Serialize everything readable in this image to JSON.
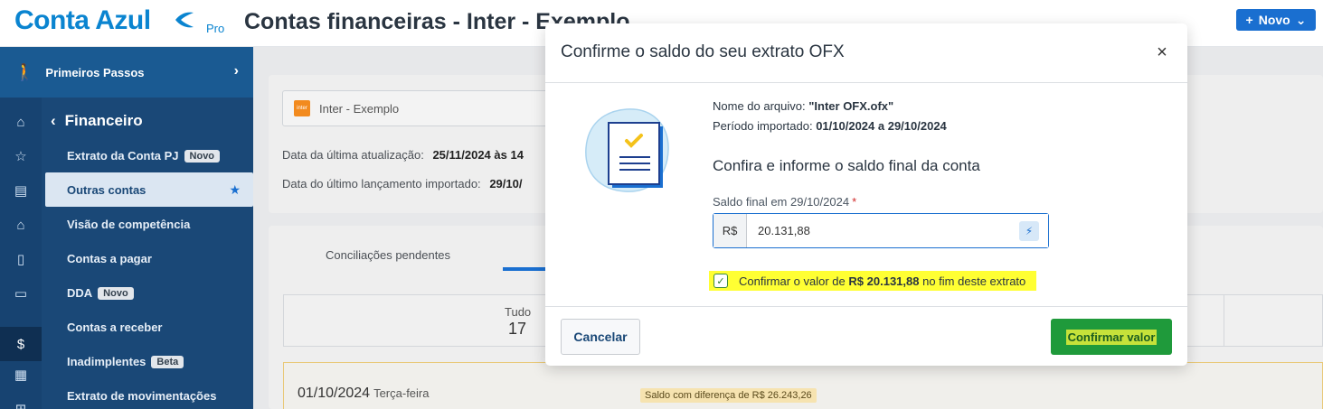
{
  "header": {
    "logo_text": "Conta Azul",
    "logo_badge": "Pro",
    "page_title": "Contas financeiras - Inter - Exemplo",
    "new_button_label": "Novo"
  },
  "sidebar": {
    "first_steps_label": "Primeiros Passos",
    "section_label": "Financeiro",
    "items": [
      {
        "label": "Extrato da Conta PJ",
        "tag": "Novo"
      },
      {
        "label": "Outras contas"
      },
      {
        "label": "Visão de competência"
      },
      {
        "label": "Contas a pagar"
      },
      {
        "label": "DDA",
        "tag": "Novo"
      },
      {
        "label": "Contas a receber"
      },
      {
        "label": "Inadimplentes",
        "tag": "Beta"
      },
      {
        "label": "Extrato de movimentações"
      }
    ]
  },
  "background": {
    "account_name": "Inter - Exemplo",
    "account_logo_text": "inter",
    "last_update_label": "Data da última atualização:",
    "last_update_value": "25/11/2024 às 14",
    "last_import_label": "Data do último lançamento importado:",
    "last_import_value": "29/10/",
    "tab_pending": "Conciliações pendentes",
    "summary_label": "Tudo",
    "summary_value": "17",
    "row_date": "01/10/2024",
    "row_weekday": "Terça-feira",
    "row_badge": "Saldo com diferença de R$ 26.243,26"
  },
  "modal": {
    "title": "Confirme o saldo do seu extrato OFX",
    "file_label": "Nome do arquivo:",
    "file_value": "\"Inter OFX.ofx\"",
    "period_label": "Período importado:",
    "period_value": "01/10/2024 a 29/10/2024",
    "subtitle": "Confira e informe o saldo final da conta",
    "field_label": "Saldo final em 29/10/2024",
    "required_mark": "*",
    "currency_prefix": "R$",
    "field_value": "20.131,88",
    "confirm_text_before": "Confirmar o valor de",
    "confirm_amount": "R$ 20.131,88",
    "confirm_text_after": "no fim deste extrato",
    "confirm_checked": true,
    "cancel_label": "Cancelar",
    "submit_label": "Confirmar valor"
  },
  "colors": {
    "brand": "#0a84d0",
    "sidebar": "#1a4877",
    "primary_button": "#1f9a3b",
    "highlight": "#ffff33"
  }
}
